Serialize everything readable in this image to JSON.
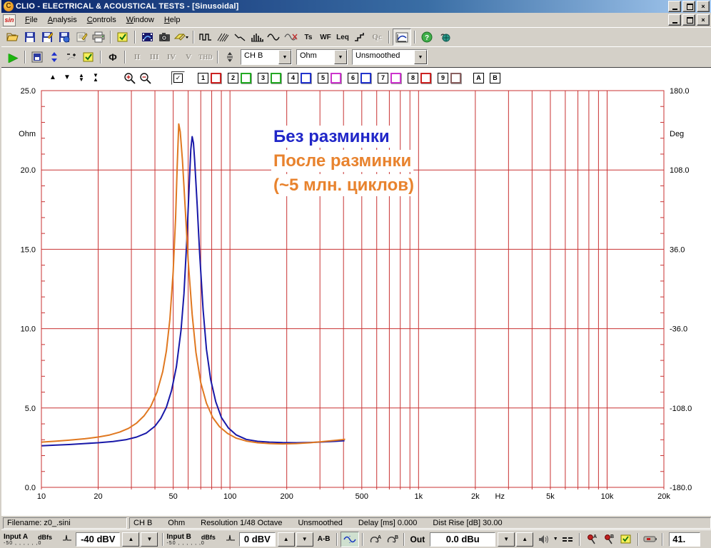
{
  "window": {
    "title": "CLIO - ELECTRICAL & ACOUSTICAL TESTS - [Sinusoidal]"
  },
  "menu": {
    "doc_icon_label": "sin",
    "items": [
      "File",
      "Analysis",
      "Controls",
      "Window",
      "Help"
    ]
  },
  "toolbar_main": {
    "text_icons": {
      "ts": "Ts",
      "wf": "WF",
      "leq": "Leq",
      "qc": "Qc"
    }
  },
  "toolbar_meas": {
    "phase": "Φ",
    "disabled": [
      "II",
      "III",
      "IV",
      "V",
      "THD"
    ],
    "channel": "CH B",
    "unit": "Ohm",
    "smoothing": "Unsmoothed"
  },
  "chart_toolbar": {
    "master_check": "✓",
    "slots": [
      {
        "n": "1",
        "color": "#cc2222"
      },
      {
        "n": "2",
        "color": "#22aa22"
      },
      {
        "n": "3",
        "color": "#22aa22"
      },
      {
        "n": "4",
        "color": "#2233cc"
      },
      {
        "n": "5",
        "color": "#cc33cc"
      },
      {
        "n": "6",
        "color": "#2233cc"
      },
      {
        "n": "7",
        "color": "#cc33cc"
      },
      {
        "n": "8",
        "color": "#cc2222"
      },
      {
        "n": "9",
        "color": "#8a6060"
      }
    ],
    "a": "A",
    "b": "B"
  },
  "chart_data": {
    "type": "line",
    "x_scale": "log",
    "x_range": [
      10,
      20000
    ],
    "grid": true,
    "grid_color": "#c83232",
    "x_ticks": [
      {
        "f": 10,
        "label": "10"
      },
      {
        "f": 20,
        "label": "20"
      },
      {
        "f": 50,
        "label": "50"
      },
      {
        "f": 100,
        "label": "100"
      },
      {
        "f": 200,
        "label": "200"
      },
      {
        "f": 500,
        "label": "500"
      },
      {
        "f": 1000,
        "label": "1k"
      },
      {
        "f": 2000,
        "label": "2k"
      },
      {
        "f": 5000,
        "label": "5k"
      },
      {
        "f": 10000,
        "label": "10k"
      },
      {
        "f": 20000,
        "label": "20k"
      }
    ],
    "x_unit_label": {
      "label": "Hz",
      "f": 2700
    },
    "y_left": {
      "label": "Ohm",
      "range": [
        0,
        25
      ],
      "minor_step": 1,
      "ticks": [
        0,
        5,
        10,
        15,
        20,
        25
      ],
      "tick_labels": [
        "0.0",
        "5.0",
        "10.0",
        "15.0",
        "20.0",
        "25.0"
      ]
    },
    "y_right": {
      "label": "Deg",
      "range": [
        -180,
        180
      ],
      "tick_labels": [
        "-180.0",
        "-108.0",
        "-36.0",
        "36.0",
        "108.0",
        "180.0"
      ]
    },
    "series": [
      {
        "name": "Без разминки",
        "color": "#1818a8",
        "points": [
          [
            10,
            2.62
          ],
          [
            12,
            2.66
          ],
          [
            14,
            2.7
          ],
          [
            17,
            2.76
          ],
          [
            20,
            2.81
          ],
          [
            24,
            2.89
          ],
          [
            28,
            3.0
          ],
          [
            32,
            3.17
          ],
          [
            36,
            3.42
          ],
          [
            40,
            3.85
          ],
          [
            43,
            4.35
          ],
          [
            46,
            5.05
          ],
          [
            49,
            6.1
          ],
          [
            52,
            7.6
          ],
          [
            55,
            9.9
          ],
          [
            57,
            12.2
          ],
          [
            59,
            15.5
          ],
          [
            61,
            19.5
          ],
          [
            62,
            21.3
          ],
          [
            63,
            22.1
          ],
          [
            64,
            21.7
          ],
          [
            65,
            20.6
          ],
          [
            67,
            17.8
          ],
          [
            69,
            14.8
          ],
          [
            72,
            11.2
          ],
          [
            75,
            8.7
          ],
          [
            79,
            6.8
          ],
          [
            84,
            5.4
          ],
          [
            90,
            4.4
          ],
          [
            98,
            3.75
          ],
          [
            108,
            3.3
          ],
          [
            122,
            3.02
          ],
          [
            140,
            2.9
          ],
          [
            162,
            2.85
          ],
          [
            190,
            2.82
          ],
          [
            225,
            2.81
          ],
          [
            265,
            2.83
          ],
          [
            310,
            2.86
          ],
          [
            360,
            2.9
          ],
          [
            405,
            2.94
          ]
        ]
      },
      {
        "name": "После разминки (~5 млн. циклов)",
        "color": "#e07820",
        "points": [
          [
            10,
            2.85
          ],
          [
            12,
            2.91
          ],
          [
            14,
            2.97
          ],
          [
            17,
            3.06
          ],
          [
            20,
            3.17
          ],
          [
            23,
            3.3
          ],
          [
            26,
            3.48
          ],
          [
            29,
            3.72
          ],
          [
            32,
            4.05
          ],
          [
            35,
            4.5
          ],
          [
            38,
            5.1
          ],
          [
            41,
            6.0
          ],
          [
            44,
            7.3
          ],
          [
            46,
            8.6
          ],
          [
            48,
            10.6
          ],
          [
            50,
            13.6
          ],
          [
            51.5,
            17.0
          ],
          [
            52.5,
            20.2
          ],
          [
            53.5,
            22.9
          ],
          [
            54.5,
            22.4
          ],
          [
            56,
            20.6
          ],
          [
            58,
            17.4
          ],
          [
            60,
            14.3
          ],
          [
            63,
            10.9
          ],
          [
            66,
            8.5
          ],
          [
            70,
            6.6
          ],
          [
            75,
            5.3
          ],
          [
            81,
            4.4
          ],
          [
            88,
            3.82
          ],
          [
            97,
            3.4
          ],
          [
            108,
            3.1
          ],
          [
            122,
            2.92
          ],
          [
            140,
            2.81
          ],
          [
            162,
            2.76
          ],
          [
            190,
            2.74
          ],
          [
            225,
            2.76
          ],
          [
            265,
            2.81
          ],
          [
            310,
            2.88
          ],
          [
            355,
            2.95
          ],
          [
            395,
            3.01
          ],
          [
            408,
            3.03
          ]
        ]
      }
    ],
    "annotations": [
      {
        "text": "Без разминки",
        "color": "#2026c8",
        "x": 381,
        "y": 104
      },
      {
        "text": "После разминки",
        "color": "#e8832e",
        "x": 381,
        "y": 138
      },
      {
        "text": "(~5 млн. циклов)",
        "color": "#e8832e",
        "x": 381,
        "y": 172
      }
    ],
    "legend_position": "none",
    "title": ""
  },
  "statusbar": {
    "filename": "Filename: z0_.sini",
    "segments": [
      "CH B",
      "Ohm",
      "Resolution 1/48 Octave",
      "Unsmoothed",
      "Delay [ms] 0.000",
      "Dist Rise [dB] 30.00"
    ]
  },
  "controlbar": {
    "input_a": {
      "label": "Input A",
      "unit": "dBfs",
      "scale": "-50 , , , , , ,0",
      "level": "-40 dBV"
    },
    "input_b": {
      "label": "Input B",
      "unit": "dBfs",
      "scale": "-50 , , , , , ,0",
      "level": "0 dBV"
    },
    "ab": "A-B",
    "out_label": "Out",
    "out_level": "0.0 dBu",
    "samplerate": "41."
  }
}
